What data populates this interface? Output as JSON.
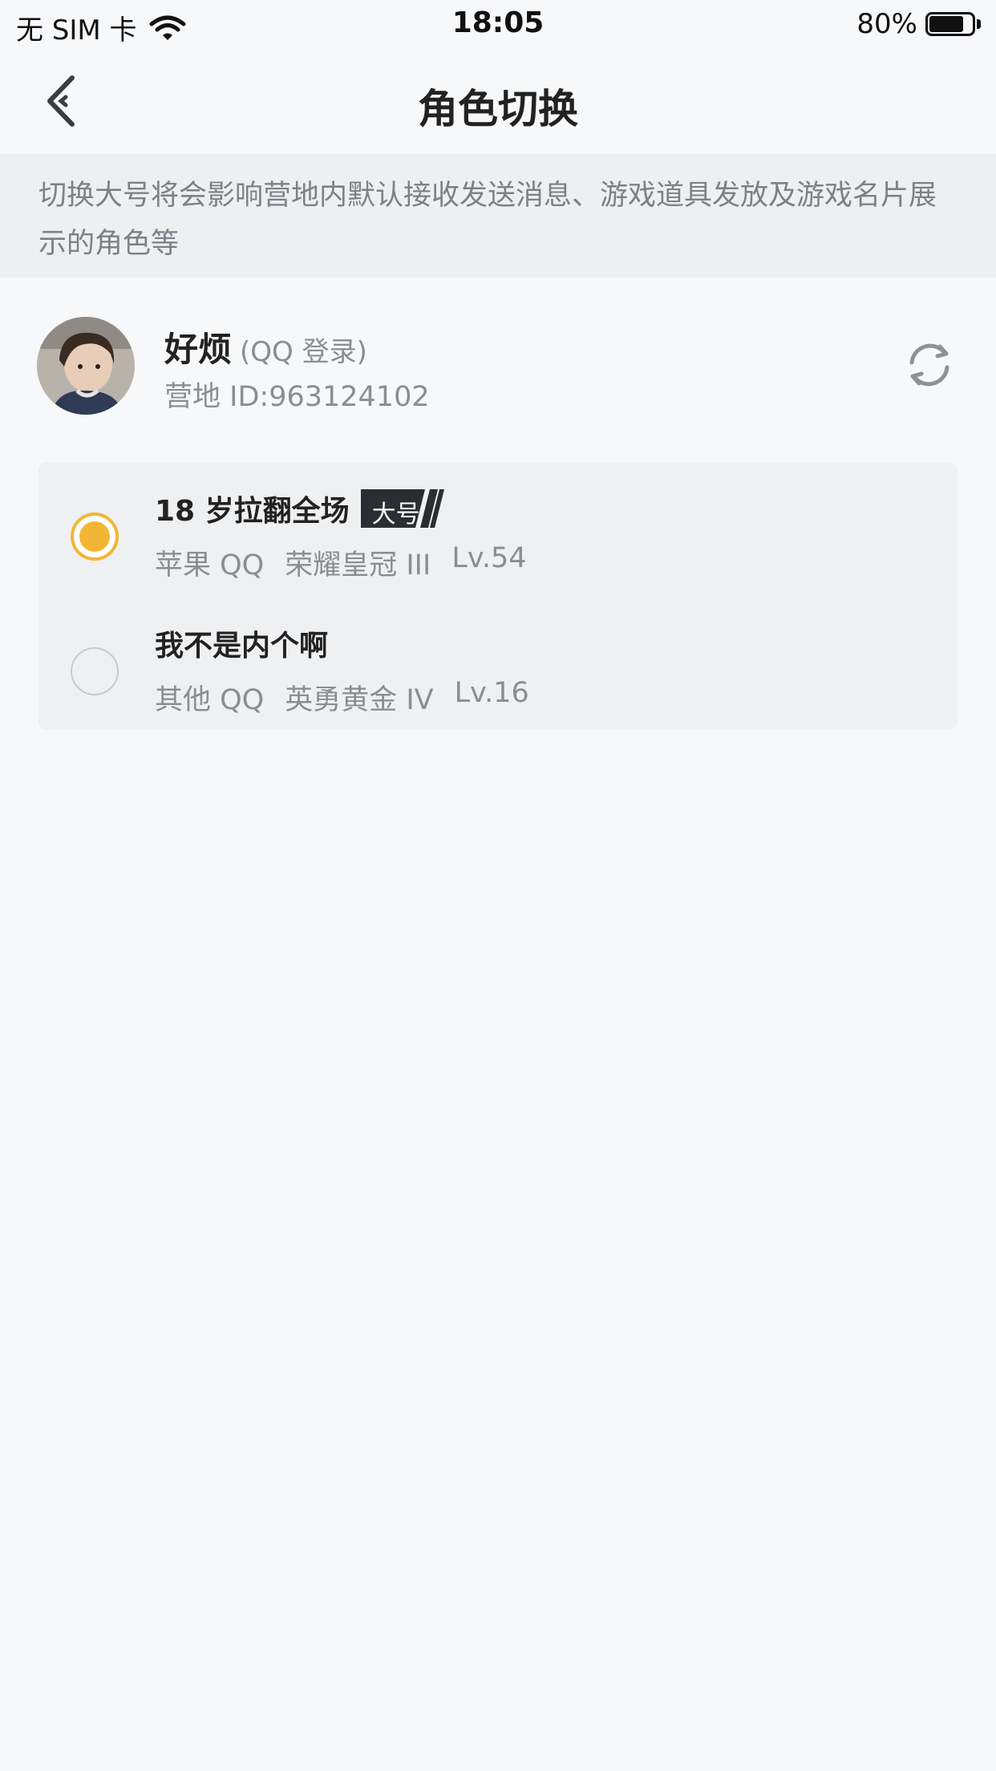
{
  "status_bar": {
    "carrier": "无 SIM 卡",
    "time": "18:05",
    "battery_percent": "80%",
    "battery_level": 0.8
  },
  "nav": {
    "title": "角色切换",
    "back_icon": "chevron-left-icon"
  },
  "notice": {
    "text": "切换大号将会影响营地内默认接收发送消息、游戏道具发放及游戏名片展示的角色等"
  },
  "profile": {
    "name": "好烦",
    "login_type": "(QQ 登录)",
    "camp_id": "营地 ID:963124102",
    "refresh_icon": "refresh-icon"
  },
  "roles": [
    {
      "name": "18 岁拉翻全场",
      "badge": "大号",
      "platform": "苹果 QQ",
      "rank": "荣耀皇冠 III",
      "level": "Lv.54",
      "selected": true
    },
    {
      "name": "我不是内个啊",
      "badge": "",
      "platform": "其他 QQ",
      "rank": "英勇黄金 IV",
      "level": "Lv.16",
      "selected": false
    }
  ],
  "colors": {
    "accent": "#f3b634",
    "background": "#f7f8fa",
    "notice_bg": "#eeeff1",
    "card_bg": "#eff0f2",
    "secondary_text": "#8a8d93"
  }
}
